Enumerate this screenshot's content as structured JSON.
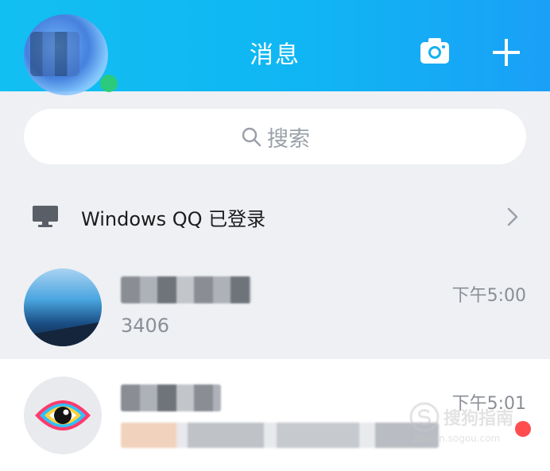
{
  "header": {
    "title": "消息",
    "camera_icon": "camera-icon",
    "add_icon": "plus-icon"
  },
  "search": {
    "placeholder": "搜索",
    "icon": "search-icon"
  },
  "device_row": {
    "label": "Windows QQ 已登录",
    "icon": "monitor-icon",
    "trailing_icon": "chevron-right-icon"
  },
  "chats": [
    {
      "name": "",
      "time": "下午5:00",
      "preview": "3406"
    },
    {
      "name": "",
      "time": "下午5:01",
      "preview": "",
      "unread_dot": true
    }
  ],
  "colors": {
    "header_start": "#12bff2",
    "header_end": "#1aa0f7",
    "background": "#eef0f4",
    "unread": "#ff4d4f"
  }
}
